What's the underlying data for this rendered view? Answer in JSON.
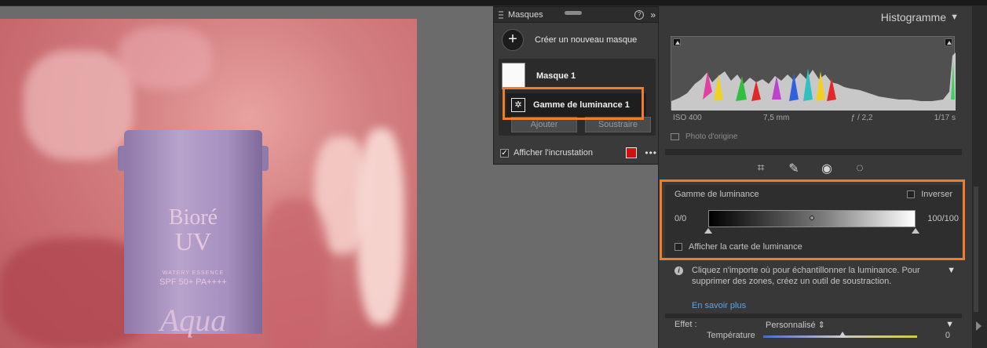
{
  "masks": {
    "title": "Masques",
    "help": "?",
    "collapse": "»",
    "create_label": "Créer un nouveau masque",
    "mask_name": "Masque 1",
    "sub_mask_name": "Gamme de luminance 1",
    "add_label": "Ajouter",
    "subtract_label": "Soustraire",
    "overlay_label": "Afficher l'incrustation",
    "overlay_color": "#d21010"
  },
  "photo": {
    "brand": "Bioré",
    "product": "UV",
    "line1": "WATERY ESSENCE",
    "line2": "SPF 50+ PA++++",
    "script": "Aqua"
  },
  "histogram": {
    "title": "Histogramme",
    "iso": "ISO 400",
    "focal": "7,5 mm",
    "aperture": "ƒ / 2,2",
    "shutter": "1/17 s",
    "original_photo": "Photo d'origine"
  },
  "luminance": {
    "title": "Gamme de luminance",
    "invert": "Inverser",
    "min_label": "0/0",
    "max_label": "100/100",
    "show_map": "Afficher la carte de luminance",
    "info": "Cliquez n'importe où pour échantillonner la luminance. Pour supprimer des zones, créez un outil de soustraction.",
    "learn_more": "En savoir plus"
  },
  "effect": {
    "label": "Effet :",
    "value": "Personnalisé",
    "temperature_label": "Température",
    "temperature_value": "0"
  },
  "colors": {
    "accent": "#ef7d2c"
  }
}
